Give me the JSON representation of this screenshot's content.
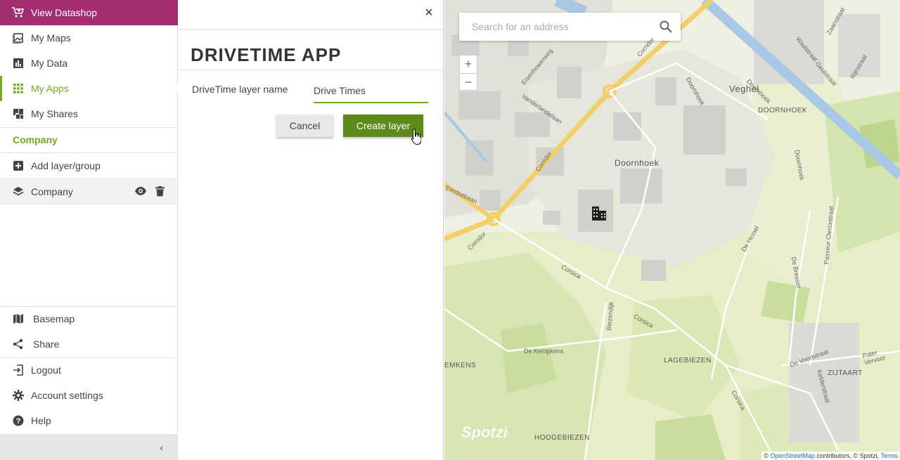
{
  "sidebar": {
    "datashop_label": "View Datashop",
    "nav": [
      {
        "label": "My Maps",
        "icon": "maps-icon"
      },
      {
        "label": "My Data",
        "icon": "chart-icon"
      },
      {
        "label": "My Apps",
        "icon": "apps-grid-icon",
        "active": true
      },
      {
        "label": "My Shares",
        "icon": "shares-icon"
      }
    ],
    "section_title": "Company",
    "add_layer_label": "Add layer/group",
    "layer_name": "Company",
    "bottom": [
      {
        "label": "Basemap",
        "icon": "map-icon"
      },
      {
        "label": "Share",
        "icon": "share-icon"
      },
      {
        "label": "Logout",
        "icon": "logout-icon"
      },
      {
        "label": "Account settings",
        "icon": "gear-icon"
      },
      {
        "label": "Help",
        "icon": "help-icon"
      }
    ],
    "collapse_glyph": "‹"
  },
  "panel": {
    "title": "DRIVETIME APP",
    "close_glyph": "×",
    "field_label": "DriveTime layer name",
    "field_value": "Drive Times",
    "cancel_label": "Cancel",
    "create_label": "Create layer"
  },
  "map": {
    "search_placeholder": "Search for an address",
    "zoom_in": "+",
    "zoom_out": "−",
    "labels": {
      "veghel": "Veghel",
      "doornhoek_caps": "DOORNHOEK",
      "doornhoek": "Doornhoek",
      "lagebiezen": "LAGEBIEZEN",
      "zijtaart": "ZIJTAART",
      "hoogebiezen": "HOOGEBIEZEN",
      "kemkens": "EMKENS"
    },
    "streets": {
      "corridor1": "Corridor",
      "corridor2": "Corridor",
      "corridor3": "Corridor",
      "corsica1": "Corsica",
      "corsica2": "Corsica",
      "corsica3": "Corsica",
      "eerdsebaan": "Eerdsebaan",
      "eisenhowerweg": "Eisenhowerweg",
      "vanderlandelaan": "Vanderlandelaan",
      "doornhoek_st": "Doornhoek",
      "doornhoek_st2": "Doornhoek",
      "doornhoek_st3": "Doornhoek",
      "dekempkens": "De Kempkens",
      "biezendijk": "Biezendijk",
      "dehemel": "De Hemel",
      "debresser": "De Bresser",
      "debresser2": "De Bresser",
      "passeurclercxstraat": "Passeur Clercxstraat",
      "devoortstraat": "De Voortstraat",
      "kelderstraat": "Kelderstraat",
      "patervervoort": "Pater Vervoor",
      "waalstraat": "Waalstraat",
      "zaanstraat": "Zaanstraat",
      "geulstraat": "Geulstraat",
      "rijnstraat": "Rijnstraat"
    },
    "spotzi": "Spotzi",
    "attribution_prefix": "© ",
    "attribution_link": "OpenStreetMap",
    "attribution_mid": " contributors, © Spotzi, ",
    "attribution_terms": "Terms"
  },
  "colors": {
    "brand_purple": "#a42d70",
    "accent_green": "#74a922",
    "button_green": "#5e8a1c"
  }
}
